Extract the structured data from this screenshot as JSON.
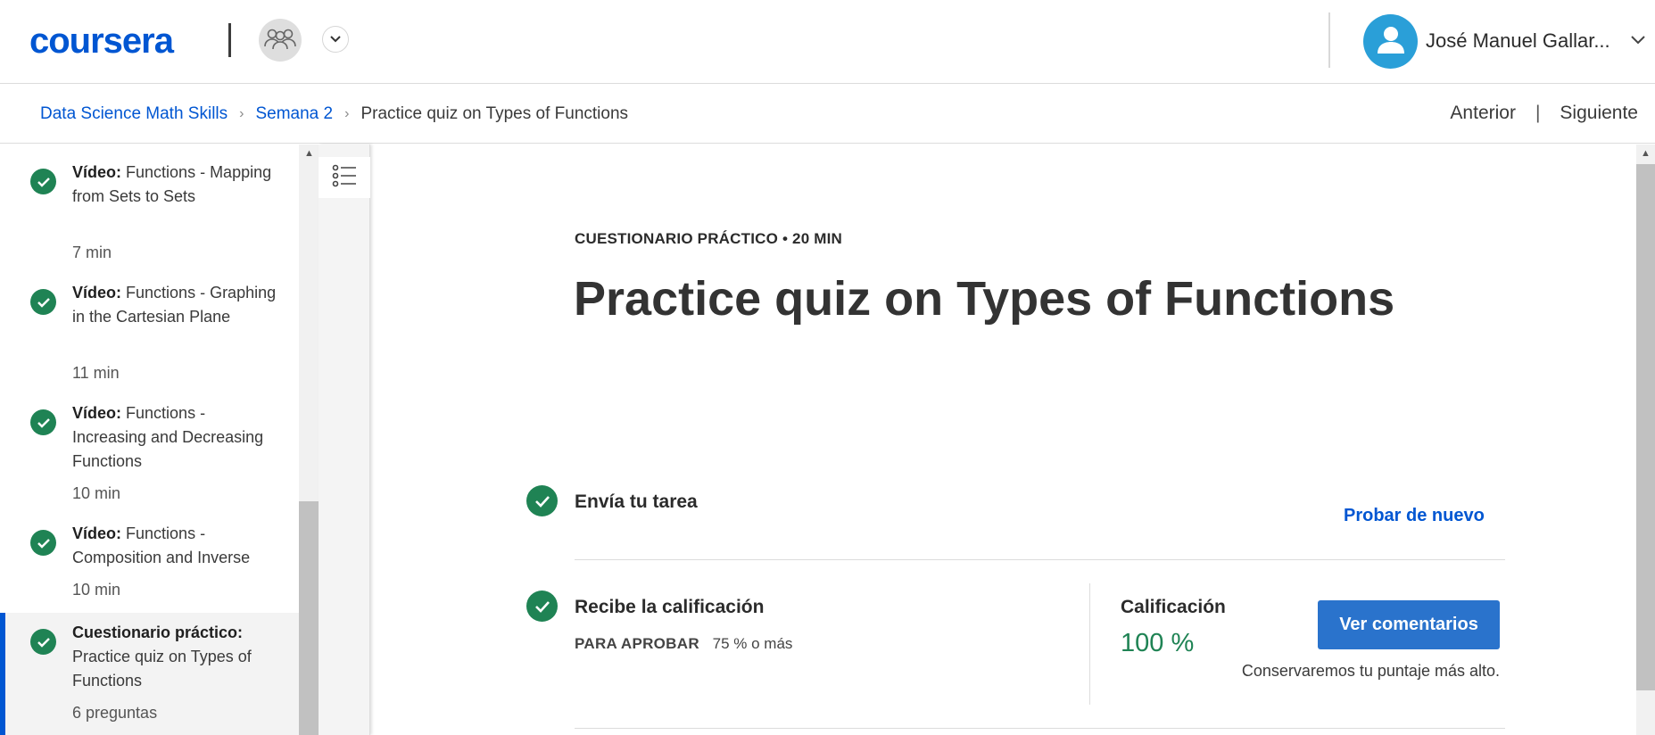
{
  "header": {
    "logo_text": "coursera",
    "user_name": "José Manuel Gallar...",
    "colors": {
      "brand": "#0056d2",
      "avatar": "#2a9fd8"
    }
  },
  "breadcrumb": {
    "course": "Data Science Math Skills",
    "week": "Semana 2",
    "current": "Practice quiz on Types of Functions",
    "prev_label": "Anterior",
    "next_label": "Siguiente"
  },
  "sidebar": {
    "items": [
      {
        "type": "Vídeo:",
        "title": "Functions - Mapping from Sets to Sets",
        "meta": "7 min"
      },
      {
        "type": "Vídeo:",
        "title": "Functions - Graphing in the Cartesian Plane",
        "meta": "11 min"
      },
      {
        "type": "Vídeo:",
        "title": "Functions - Increasing and Decreasing Functions",
        "meta": "10 min"
      },
      {
        "type": "Vídeo:",
        "title": "Functions - Composition and Inverse",
        "meta": "10 min"
      },
      {
        "type": "Cuestionario práctico:",
        "title": "Practice quiz on Types of Functions",
        "meta": "6 preguntas"
      }
    ]
  },
  "main": {
    "eyebrow": "CUESTIONARIO PRÁCTICO • 20 MIN",
    "title": "Practice quiz on Types of Functions",
    "step1_title": "Envía tu tarea",
    "retry_label": "Probar de nuevo",
    "step2_title": "Recibe la calificación",
    "pass_label": "PARA APROBAR",
    "pass_value": "75 % o más",
    "grade_label": "Calificación",
    "grade_value": "100 %",
    "feedback_button": "Ver comentarios",
    "keep_note": "Conservaremos tu puntaje más alto.",
    "colors": {
      "success": "#1f8354",
      "button": "#2a73cc"
    }
  }
}
